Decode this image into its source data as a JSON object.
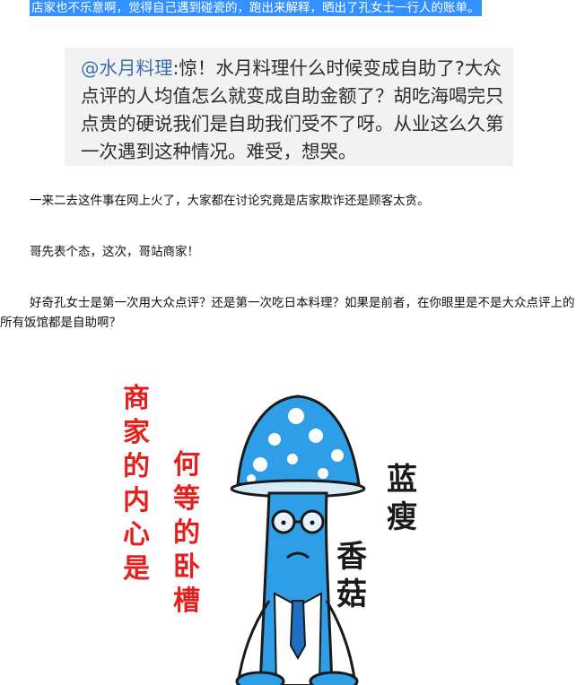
{
  "selected_line": "店家也不乐意啊，觉得自己遇到碰瓷的，跑出来解释，晒出了孔女士一行人的账单。",
  "quote": {
    "handle": "@水月料理",
    "text": ":惊！水月料理什么时候变成自助了?大众点评的人均值怎么就变成自助金额了？胡吃海喝完只点贵的硬说我们是自助我们受不了呀。从业这么久第一次遇到这种情况。难受，想哭。"
  },
  "paragraphs": [
    "一来二去这件事在网上火了，大家都在讨论究竟是店家欺诈还是顾客太贪。",
    "哥先表个态，这次，哥站商家！",
    "好奇孔女士是第一次用大众点评？还是第一次吃日本料理？如果是前者，在你眼里是不是大众点评上的所有饭馆都是自助啊？"
  ],
  "illustration": {
    "red_col1": [
      "商",
      "家",
      "的",
      "内",
      "心",
      "是"
    ],
    "red_col2": [
      "何",
      "等",
      "的",
      "卧",
      "槽"
    ],
    "black_col1": [
      "蓝",
      "瘦"
    ],
    "black_col2": [
      "香",
      "菇"
    ]
  },
  "colors": {
    "selection": "#3390ff",
    "quote_bg": "#f2f2f2",
    "handle": "#3c6fb0",
    "mushroom_blue": "#2e9fe6",
    "red_text": "#e3201e"
  }
}
